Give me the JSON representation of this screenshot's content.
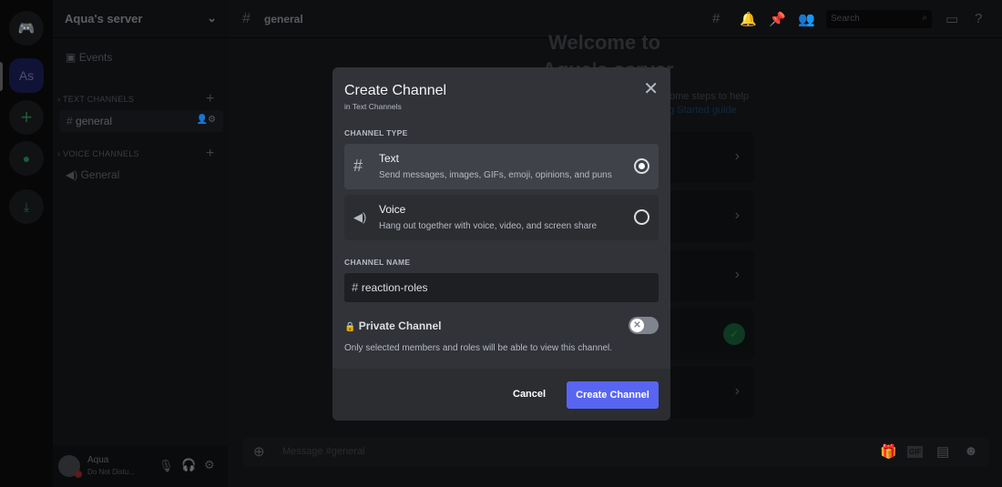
{
  "server": {
    "name": "Aqua's server",
    "initials": "As"
  },
  "sidebar": {
    "events": "Events",
    "text_category": "TEXT CHANNELS",
    "text_channels": [
      {
        "name": "general"
      }
    ],
    "voice_category": "VOICE CHANNELS",
    "voice_channels": [
      {
        "name": "General"
      }
    ]
  },
  "user": {
    "name": "Aqua",
    "status": "Do Not Distu..."
  },
  "header": {
    "channel": "general",
    "search_placeholder": "Search"
  },
  "welcome": {
    "title_line1": "Welcome to",
    "title_line2": "Aqua's server",
    "text": "ome steps to help",
    "link": "ng Started guide"
  },
  "composer": {
    "placeholder": "Message #general",
    "gif": "GIF"
  },
  "modal": {
    "title": "Create Channel",
    "subtitle": "in Text Channels",
    "channel_type_label": "CHANNEL TYPE",
    "options": [
      {
        "name": "Text",
        "description": "Send messages, images, GIFs, emoji, opinions, and puns",
        "selected": true,
        "icon": "hash-icon"
      },
      {
        "name": "Voice",
        "description": "Hang out together with voice, video, and screen share",
        "selected": false,
        "icon": "speaker-icon"
      }
    ],
    "channel_name_label": "CHANNEL NAME",
    "channel_name_value": "reaction-roles",
    "private_label": "Private Channel",
    "private_enabled": false,
    "private_description": "Only selected members and roles will be able to view this channel.",
    "cancel": "Cancel",
    "create": "Create Channel"
  },
  "colors": {
    "accent": "#5865f2",
    "modal_bg": "#313338"
  }
}
